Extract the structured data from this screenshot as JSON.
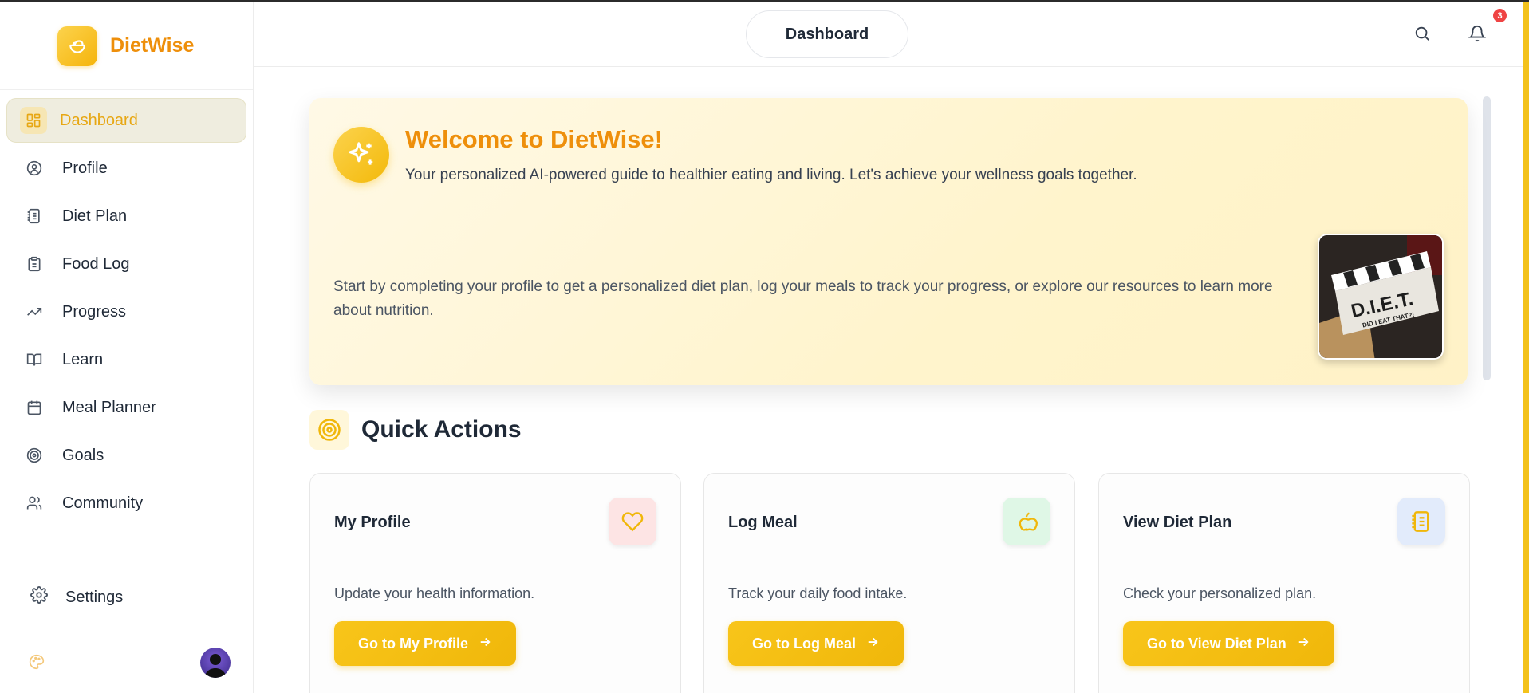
{
  "app": {
    "name": "DietWise",
    "brand_color": "#ee8f0b",
    "accent": "#f3b90a"
  },
  "sidebar": {
    "items": [
      {
        "label": "Dashboard",
        "icon": "grid-icon",
        "active": true
      },
      {
        "label": "Profile",
        "icon": "user-circle-icon"
      },
      {
        "label": "Diet Plan",
        "icon": "notebook-icon"
      },
      {
        "label": "Food Log",
        "icon": "clipboard-icon"
      },
      {
        "label": "Progress",
        "icon": "trending-up-icon"
      },
      {
        "label": "Learn",
        "icon": "book-open-icon"
      },
      {
        "label": "Meal Planner",
        "icon": "calendar-icon"
      },
      {
        "label": "Goals",
        "icon": "target-icon"
      },
      {
        "label": "Community",
        "icon": "users-icon"
      }
    ],
    "settings_label": "Settings"
  },
  "header": {
    "title": "Dashboard",
    "notification_count": "3"
  },
  "welcome": {
    "title": "Welcome to DietWise!",
    "subtitle": "Your personalized AI-powered guide to healthier eating and living. Let's achieve your wellness goals together.",
    "body": "Start by completing your profile to get a personalized diet plan, log your meals to track your progress, or explore our resources to learn more about nutrition.",
    "image_text": "D.I.E.T.",
    "image_subtext": "DID I EAT THAT?!"
  },
  "quick_actions": {
    "title": "Quick Actions",
    "cards": [
      {
        "title": "My Profile",
        "description": "Update your health information.",
        "button": "Go to My Profile",
        "icon": "heart-icon",
        "icon_bg": "#fde4e4"
      },
      {
        "title": "Log Meal",
        "description": "Track your daily food intake.",
        "button": "Go to Log Meal",
        "icon": "apple-icon",
        "icon_bg": "#dff7e6"
      },
      {
        "title": "View Diet Plan",
        "description": "Check your personalized plan.",
        "button": "Go to View Diet Plan",
        "icon": "notebook-icon",
        "icon_bg": "#e2ebfb"
      }
    ]
  }
}
